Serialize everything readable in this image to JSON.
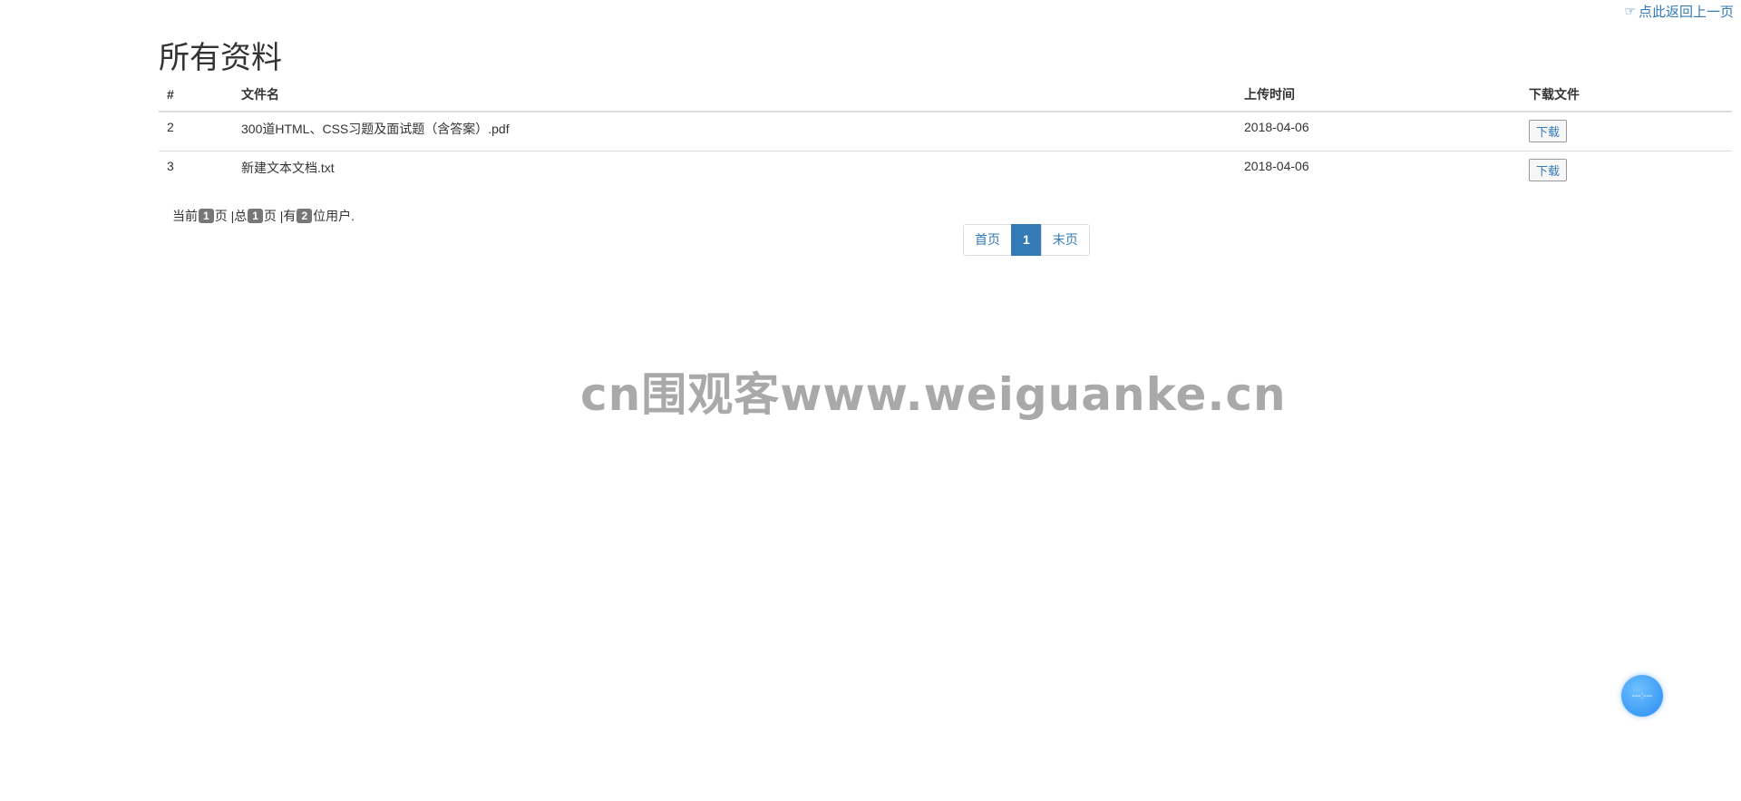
{
  "back_link": {
    "label": "点此返回上一页",
    "icon": "hand-pointer-icon"
  },
  "page_title": "所有资料",
  "table": {
    "headers": [
      "#",
      "文件名",
      "上传时间",
      "下载文件"
    ],
    "rows": [
      {
        "num": "2",
        "name": "300道HTML、CSS习题及面试题（含答案）.pdf",
        "time": "2018-04-06",
        "action": "下载"
      },
      {
        "num": "3",
        "name": "新建文本文档.txt",
        "time": "2018-04-06",
        "action": "下载"
      }
    ]
  },
  "pager_info": {
    "t1": "当前",
    "current": "1",
    "t2": "页 |总",
    "total": "1",
    "t3": "页 |有",
    "users": "2",
    "t4": "位用户."
  },
  "pagination": {
    "first": "首页",
    "page": "1",
    "last": "末页"
  },
  "watermark": "cn围观客www.weiguanke.cn",
  "float_button": {
    "label": "---:---",
    "icon": "floating-action-icon"
  },
  "colors": {
    "link": "#337ab7",
    "badge": "#777777",
    "watermark": "#a9a9a9"
  }
}
